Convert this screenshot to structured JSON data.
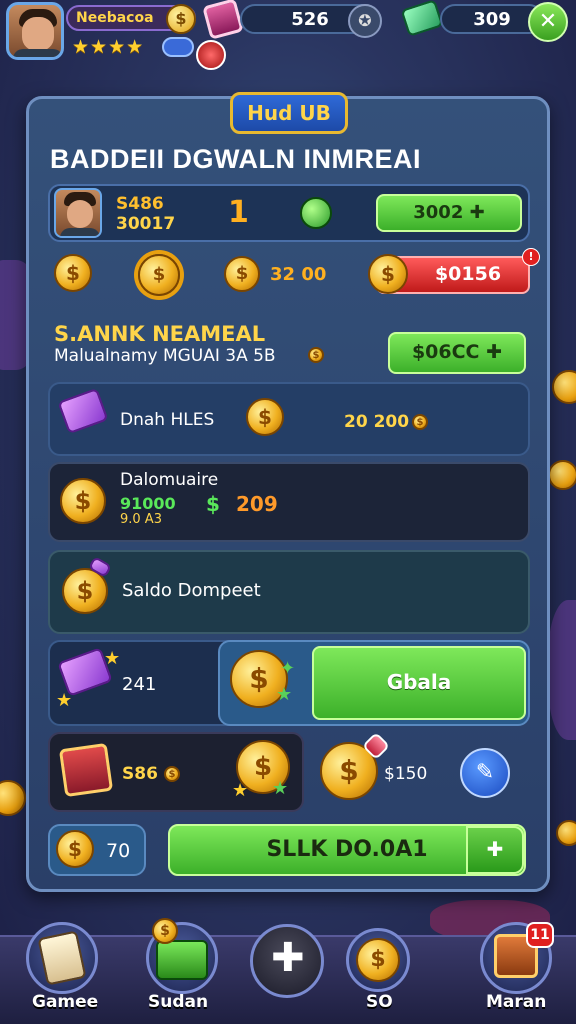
{
  "topbar": {
    "player_name": "Neebacoa",
    "stars": [
      "★",
      "★",
      "★",
      "★"
    ],
    "coins_value": "526",
    "cash_value": "309"
  },
  "panel": {
    "tab_label": "Hud UB",
    "title": "BADDEII DGWALN INMREAI",
    "profile_row": {
      "stat_line1": "S486",
      "stat_line2": "30017",
      "level": "1",
      "button_label": "3002"
    },
    "coin_row": {
      "amount": "32 00",
      "red_button_label": "$0156"
    },
    "section": {
      "heading": "S.ANNK NEAMEAL",
      "subtext": "Malualnamy MGUAI 3A 5B",
      "button_label": "$06CC"
    },
    "rows": [
      {
        "label": "Dnah HLES",
        "amount": "20 200"
      },
      {
        "label": "Dalomuaire",
        "green_value": "91000",
        "sub_value": "9.0 A3",
        "dollar": "$",
        "amount": "209"
      },
      {
        "label": "Saldo Dompeet"
      },
      {
        "amount": "241",
        "button_label": "Gbala"
      },
      {
        "amount": "S86",
        "amount2": "$150"
      }
    ],
    "bottom": {
      "coin_amount": "70",
      "button_label": "SLLK DO.0A1"
    }
  },
  "nav": {
    "items": [
      {
        "label": "Gamee"
      },
      {
        "label": "Sudan"
      },
      {
        "label": ""
      },
      {
        "label": "SO"
      },
      {
        "label": "Maran",
        "badge": "11"
      }
    ]
  },
  "colors": {
    "accent_gold": "#ffd54a",
    "green": "#3cb02a",
    "red": "#c01a1a",
    "panel": "#2a3f68"
  }
}
